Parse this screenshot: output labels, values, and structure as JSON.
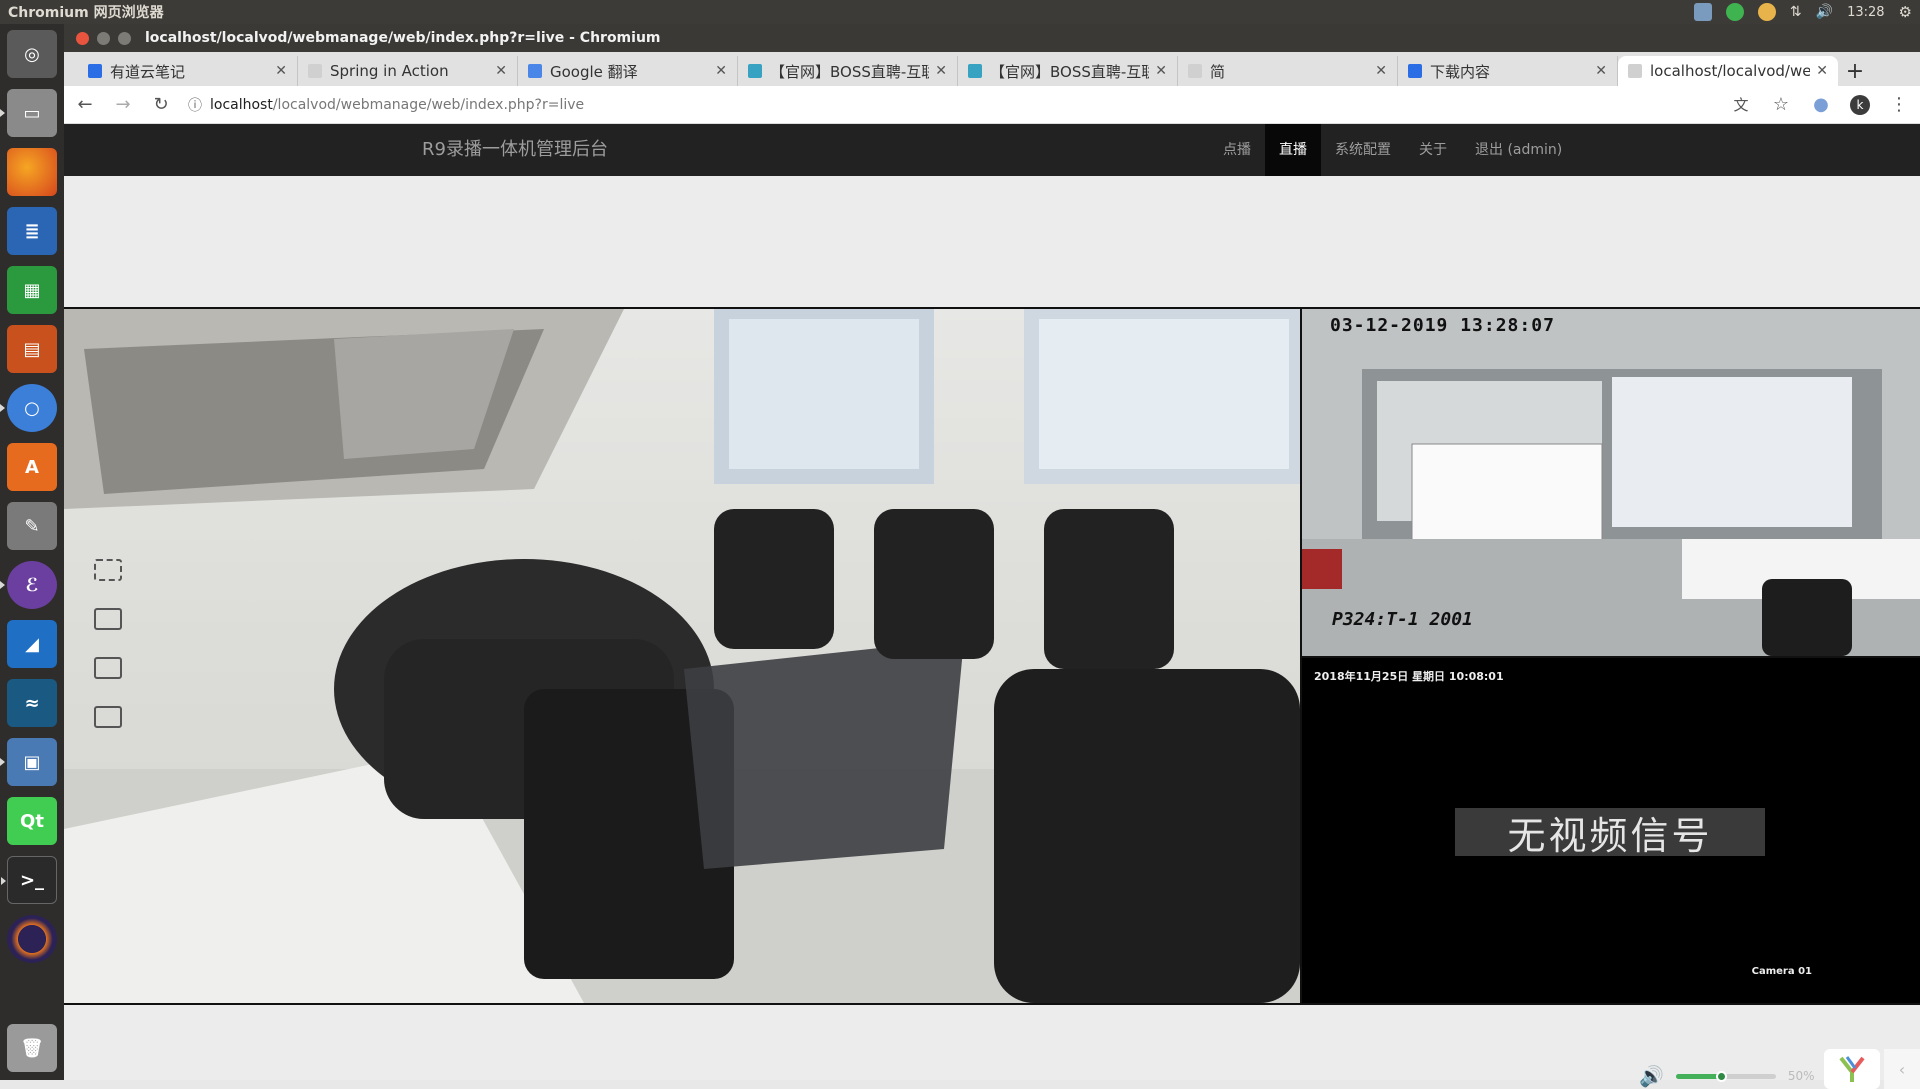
{
  "system": {
    "app_name": "Chromium 网页浏览器",
    "clock": "13:28"
  },
  "window": {
    "title": "localhost/localvod/webmanage/web/index.php?r=live - Chromium"
  },
  "tabs": [
    {
      "label": "有道云笔记",
      "icon_color": "#2b6de5"
    },
    {
      "label": "Spring in Action",
      "icon_color": "#bdbdbd"
    },
    {
      "label": "Google 翻译",
      "icon_color": "#4a86e8"
    },
    {
      "label": "【官网】BOSS直聘-互联",
      "icon_color": "#38a2c2"
    },
    {
      "label": "【官网】BOSS直聘-互联",
      "icon_color": "#38a2c2"
    },
    {
      "label": "简",
      "icon_color": "#bdbdbd"
    },
    {
      "label": "下载内容",
      "icon_color": "#2b6de5"
    },
    {
      "label": "localhost/localvod/web",
      "icon_color": "#bdbdbd"
    }
  ],
  "address": {
    "host": "localhost",
    "path": "/localvod/webmanage/web/index.php?r=live"
  },
  "profile_initial": "k",
  "site": {
    "brand": "R9录播一体机管理后台",
    "nav": [
      "点播",
      "直播",
      "系统配置",
      "关于",
      "退出 (admin)"
    ],
    "active_nav": "直播"
  },
  "video": {
    "cam1_timestamp": "03-12-2019 13:28:07",
    "cam1_label": "P324:T-1   2001",
    "cam2_timestamp": "2018年11月25日 星期日 10:08:01",
    "no_signal": "无视频信号",
    "cam2_label": "Camera 01"
  },
  "volume": {
    "percent_text": "50%",
    "level": 0.5
  },
  "launcher": [
    "dash-icon",
    "files-icon",
    "firefox-icon",
    "writer-icon",
    "calc-icon",
    "impress-icon",
    "chromium-icon",
    "software-center-icon",
    "system-settings-icon",
    "emacs-icon",
    "wireshark-icon",
    "mysql-workbench-icon",
    "remote-desktop-icon",
    "qt-creator-icon",
    "terminal-icon",
    "eclipse-icon",
    "trash-icon"
  ]
}
